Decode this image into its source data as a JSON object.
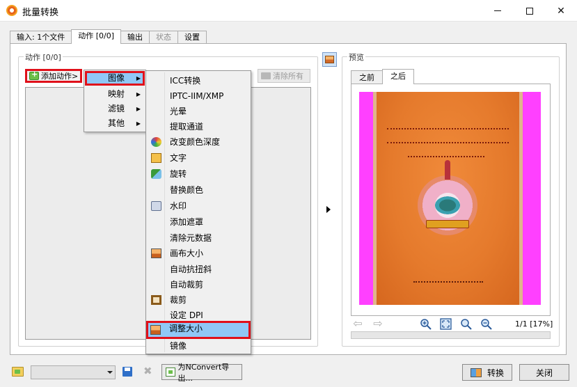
{
  "window": {
    "title": "批量转换",
    "minimize": "—",
    "maximize": "☐",
    "close": "✕"
  },
  "tabs": [
    {
      "label": "输入: 1个文件",
      "state": "normal"
    },
    {
      "label": "动作 [0/0]",
      "state": "active"
    },
    {
      "label": "输出",
      "state": "normal"
    },
    {
      "label": "状态",
      "state": "disabled"
    },
    {
      "label": "设置",
      "state": "normal"
    }
  ],
  "actions_group": {
    "label": "动作 [0/0]",
    "add_action_label": "添加动作>",
    "clear_all_label": "清除所有"
  },
  "category_menu": {
    "items": [
      {
        "label": "图像",
        "highlighted": true
      },
      {
        "label": "映射",
        "highlighted": false
      },
      {
        "label": "滤镜",
        "highlighted": false
      },
      {
        "label": "其他",
        "highlighted": false
      }
    ],
    "submenu_arrow": "▶"
  },
  "image_submenu": {
    "items": [
      {
        "label": "ICC转换",
        "icon": ""
      },
      {
        "label": "IPTC-IIM/XMP",
        "icon": ""
      },
      {
        "label": "光晕",
        "icon": ""
      },
      {
        "label": "提取通道",
        "icon": ""
      },
      {
        "label": "改变颜色深度",
        "icon": "color-depth-icon"
      },
      {
        "label": "文字",
        "icon": "text-icon"
      },
      {
        "label": "旋转",
        "icon": "rotate-icon"
      },
      {
        "label": "替换颜色",
        "icon": ""
      },
      {
        "label": "水印",
        "icon": "watermark-icon"
      },
      {
        "label": "添加遮罩",
        "icon": ""
      },
      {
        "label": "清除元数据",
        "icon": ""
      },
      {
        "label": "画布大小",
        "icon": "canvas-size-icon"
      },
      {
        "label": "自动抗扭斜",
        "icon": ""
      },
      {
        "label": "自动裁剪",
        "icon": ""
      },
      {
        "label": "裁剪",
        "icon": "crop-icon"
      },
      {
        "label": "设定 DPI",
        "icon": ""
      },
      {
        "label": "调整大小",
        "icon": "resize-icon",
        "highlighted": true
      },
      {
        "label": "镜像",
        "icon": ""
      }
    ]
  },
  "preview": {
    "group_label": "预览",
    "tabs": [
      {
        "label": "之前",
        "active": false
      },
      {
        "label": "之后",
        "active": true
      }
    ],
    "page_info": "1/1 [17%]",
    "nav": {
      "prev": "⇦",
      "next": "⇨"
    }
  },
  "bottom": {
    "export_nconvert_label": "为NConvert导出...",
    "convert_label": "转换",
    "close_label": "关闭",
    "preset_value": ""
  },
  "colors": {
    "highlight": "#90c8f6",
    "annotation_red": "#e0101a",
    "preview_background": "#ff40ff",
    "book_cover": "#e57a2c"
  }
}
